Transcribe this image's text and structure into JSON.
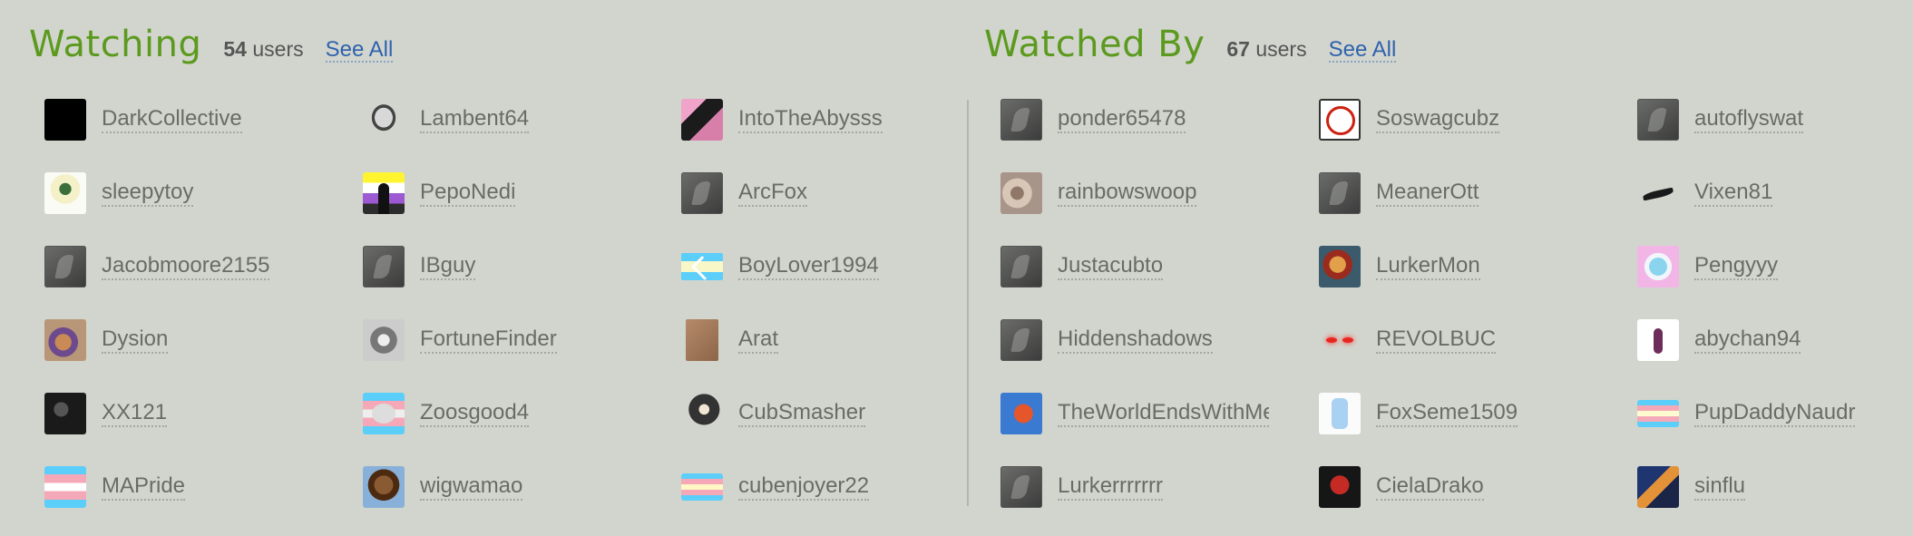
{
  "watching": {
    "title": "Watching",
    "count": "54",
    "count_suffix": "users",
    "see_all": "See All",
    "users": [
      {
        "name": "DarkCollective",
        "avatar": "av-black"
      },
      {
        "name": "sleepytoy",
        "avatar": "av-light"
      },
      {
        "name": "Jacobmoore2155",
        "avatar": "av-default"
      },
      {
        "name": "Dysion",
        "avatar": "av-brown"
      },
      {
        "name": "XX121",
        "avatar": "av-dark"
      },
      {
        "name": "MAPride",
        "avatar": "av-pride"
      },
      {
        "name": "Lambent64",
        "avatar": "av-goat"
      },
      {
        "name": "PepoNedi",
        "avatar": "av-enby"
      },
      {
        "name": "IBguy",
        "avatar": "av-default"
      },
      {
        "name": "FortuneFinder",
        "avatar": "av-wolf"
      },
      {
        "name": "Zoosgood4",
        "avatar": "av-fox"
      },
      {
        "name": "wigwamao",
        "avatar": "av-face"
      },
      {
        "name": "IntoTheAbysss",
        "avatar": "av-abyss"
      },
      {
        "name": "ArcFox",
        "avatar": "av-default"
      },
      {
        "name": "BoyLover1994",
        "avatar": "av-blueflag"
      },
      {
        "name": "Arat",
        "avatar": "av-arat"
      },
      {
        "name": "CubSmasher",
        "avatar": "av-cub"
      },
      {
        "name": "cubenjoyer22",
        "avatar": "av-stripe"
      }
    ]
  },
  "watched_by": {
    "title": "Watched By",
    "count": "67",
    "count_suffix": "users",
    "see_all": "See All",
    "users": [
      {
        "name": "ponder65478",
        "avatar": "av-default"
      },
      {
        "name": "rainbowswoop",
        "avatar": "av-rainbow"
      },
      {
        "name": "Justacubto",
        "avatar": "av-default"
      },
      {
        "name": "Hiddenshadows",
        "avatar": "av-default"
      },
      {
        "name": "TheWorldEndsWithMe",
        "avatar": "av-brickred"
      },
      {
        "name": "Lurkerrrrrrr",
        "avatar": "av-default"
      },
      {
        "name": "Soswagcubz",
        "avatar": "av-sos"
      },
      {
        "name": "MeanerOtt",
        "avatar": "av-default"
      },
      {
        "name": "LurkerMon",
        "avatar": "av-lurker"
      },
      {
        "name": "REVOLBUC",
        "avatar": "av-revol"
      },
      {
        "name": "FoxSeme1509",
        "avatar": "av-bottle"
      },
      {
        "name": "CielaDrako",
        "avatar": "av-ciela"
      },
      {
        "name": "autoflyswat",
        "avatar": "av-default"
      },
      {
        "name": "Vixen81",
        "avatar": "av-vixen"
      },
      {
        "name": "Pengyyy",
        "avatar": "av-peng"
      },
      {
        "name": "abychan94",
        "avatar": "av-aby"
      },
      {
        "name": "PupDaddyNaudr",
        "avatar": "av-stripe2"
      },
      {
        "name": "sinflu",
        "avatar": "av-sinflu"
      }
    ]
  }
}
